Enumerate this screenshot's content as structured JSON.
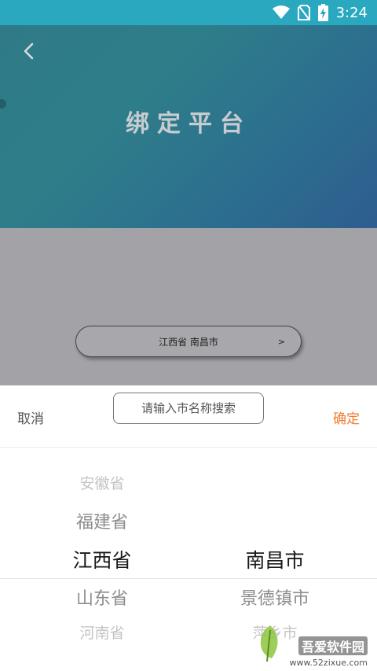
{
  "status_bar": {
    "time": "3:24"
  },
  "header": {
    "title": "绑定平台"
  },
  "region_selector": {
    "value": "江西省 南昌市",
    "arrow": ">"
  },
  "picker": {
    "cancel_label": "取消",
    "confirm_label": "确定",
    "search_placeholder": "请输入市名称搜索",
    "provinces": [
      "安徽省",
      "福建省",
      "江西省",
      "山东省",
      "河南省"
    ],
    "selected_province": "江西省",
    "cities": [
      "南昌市",
      "景德镇市",
      "萍乡市"
    ],
    "selected_city": "南昌市"
  },
  "watermark": {
    "brand": "吾爱软件园",
    "url": "www.52zixue.com"
  },
  "colors": {
    "accent": "#f07a2c",
    "header_start": "#2f7a86",
    "header_end": "#2e5d8f",
    "status_bar": "#2aa8c0"
  }
}
